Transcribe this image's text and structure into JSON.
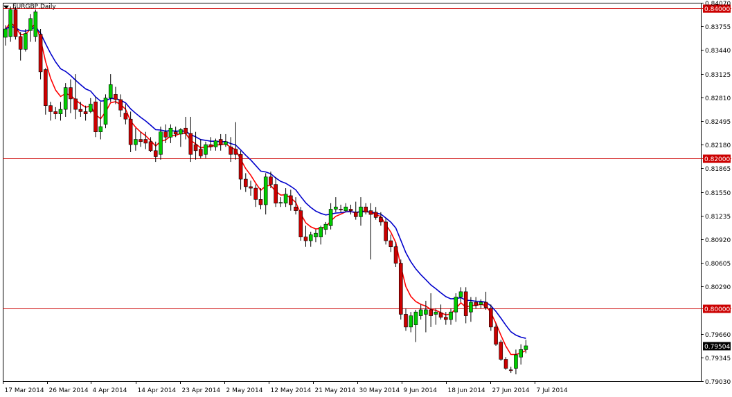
{
  "window": {
    "title": "EURGBP,Daily"
  },
  "chart_data": {
    "type": "candlestick",
    "symbol": "EURGBP",
    "timeframe": "Daily",
    "ylim": [
      0.7903,
      0.8407
    ],
    "y_ticks": [
      "0.84070",
      "0.83755",
      "0.83440",
      "0.83125",
      "0.82810",
      "0.82495",
      "0.82180",
      "0.81865",
      "0.81550",
      "0.81235",
      "0.80920",
      "0.80605",
      "0.80290",
      "0.79660",
      "0.79345",
      "0.79030"
    ],
    "x_ticks": [
      "17 Mar 2014",
      "26 Mar 2014",
      "4 Apr 2014",
      "14 Apr 2014",
      "23 Apr 2014",
      "2 May 2014",
      "12 May 2014",
      "21 May 2014",
      "30 May 2014",
      "9 Jun 2014",
      "18 Jun 2014",
      "27 Jun 2014",
      "7 Jul 2014"
    ],
    "horizontal_lines": [
      {
        "value": 0.84,
        "label": "0.84000"
      },
      {
        "value": 0.82,
        "label": "0.82000"
      },
      {
        "value": 0.8,
        "label": "0.80000"
      }
    ],
    "current_price": {
      "value": 0.79504,
      "label": "0.79504"
    },
    "candles": [
      {
        "o": 0.8361,
        "h": 0.8377,
        "l": 0.835,
        "c": 0.8372
      },
      {
        "o": 0.8362,
        "h": 0.8402,
        "l": 0.8355,
        "c": 0.8398
      },
      {
        "o": 0.8398,
        "h": 0.8402,
        "l": 0.8358,
        "c": 0.8362
      },
      {
        "o": 0.8362,
        "h": 0.8368,
        "l": 0.833,
        "c": 0.8345
      },
      {
        "o": 0.8345,
        "h": 0.8372,
        "l": 0.8342,
        "c": 0.8366
      },
      {
        "o": 0.837,
        "h": 0.8392,
        "l": 0.8355,
        "c": 0.8386
      },
      {
        "o": 0.8362,
        "h": 0.8398,
        "l": 0.8355,
        "c": 0.8395
      },
      {
        "o": 0.8365,
        "h": 0.8372,
        "l": 0.8305,
        "c": 0.8315
      },
      {
        "o": 0.8318,
        "h": 0.832,
        "l": 0.8258,
        "c": 0.827
      },
      {
        "o": 0.827,
        "h": 0.8275,
        "l": 0.825,
        "c": 0.8262
      },
      {
        "o": 0.8262,
        "h": 0.8268,
        "l": 0.8252,
        "c": 0.8259
      },
      {
        "o": 0.8259,
        "h": 0.8275,
        "l": 0.825,
        "c": 0.8265
      },
      {
        "o": 0.8265,
        "h": 0.83,
        "l": 0.8255,
        "c": 0.8294
      },
      {
        "o": 0.8294,
        "h": 0.8305,
        "l": 0.826,
        "c": 0.8279
      },
      {
        "o": 0.8279,
        "h": 0.8312,
        "l": 0.8252,
        "c": 0.8265
      },
      {
        "o": 0.8265,
        "h": 0.8275,
        "l": 0.8255,
        "c": 0.8262
      },
      {
        "o": 0.8262,
        "h": 0.827,
        "l": 0.825,
        "c": 0.8259
      },
      {
        "o": 0.8262,
        "h": 0.828,
        "l": 0.826,
        "c": 0.8272
      },
      {
        "o": 0.8275,
        "h": 0.8282,
        "l": 0.8228,
        "c": 0.8235
      },
      {
        "o": 0.8235,
        "h": 0.8275,
        "l": 0.8225,
        "c": 0.8242
      },
      {
        "o": 0.8245,
        "h": 0.8285,
        "l": 0.824,
        "c": 0.828
      },
      {
        "o": 0.828,
        "h": 0.8312,
        "l": 0.8275,
        "c": 0.8298
      },
      {
        "o": 0.8285,
        "h": 0.8295,
        "l": 0.8272,
        "c": 0.8278
      },
      {
        "o": 0.8278,
        "h": 0.8285,
        "l": 0.8255,
        "c": 0.8264
      },
      {
        "o": 0.826,
        "h": 0.8272,
        "l": 0.8245,
        "c": 0.8252
      },
      {
        "o": 0.8252,
        "h": 0.8262,
        "l": 0.8208,
        "c": 0.8218
      },
      {
        "o": 0.8218,
        "h": 0.824,
        "l": 0.821,
        "c": 0.8225
      },
      {
        "o": 0.8225,
        "h": 0.8235,
        "l": 0.8215,
        "c": 0.8222
      },
      {
        "o": 0.8225,
        "h": 0.8235,
        "l": 0.8212,
        "c": 0.822
      },
      {
        "o": 0.8222,
        "h": 0.8228,
        "l": 0.8208,
        "c": 0.821
      },
      {
        "o": 0.821,
        "h": 0.8222,
        "l": 0.8195,
        "c": 0.8202
      },
      {
        "o": 0.8205,
        "h": 0.8242,
        "l": 0.8198,
        "c": 0.8235
      },
      {
        "o": 0.8235,
        "h": 0.8245,
        "l": 0.822,
        "c": 0.8228
      },
      {
        "o": 0.8228,
        "h": 0.8245,
        "l": 0.822,
        "c": 0.824
      },
      {
        "o": 0.8235,
        "h": 0.8242,
        "l": 0.8228,
        "c": 0.8232
      },
      {
        "o": 0.8232,
        "h": 0.824,
        "l": 0.8215,
        "c": 0.8238
      },
      {
        "o": 0.824,
        "h": 0.8255,
        "l": 0.8225,
        "c": 0.8233
      },
      {
        "o": 0.8233,
        "h": 0.8255,
        "l": 0.8195,
        "c": 0.8205
      },
      {
        "o": 0.8218,
        "h": 0.8235,
        "l": 0.8198,
        "c": 0.821
      },
      {
        "o": 0.8212,
        "h": 0.8225,
        "l": 0.82,
        "c": 0.8203
      },
      {
        "o": 0.8205,
        "h": 0.8222,
        "l": 0.82,
        "c": 0.8218
      },
      {
        "o": 0.8218,
        "h": 0.8228,
        "l": 0.821,
        "c": 0.8215
      },
      {
        "o": 0.8215,
        "h": 0.8226,
        "l": 0.821,
        "c": 0.8223
      },
      {
        "o": 0.8225,
        "h": 0.8232,
        "l": 0.821,
        "c": 0.8218
      },
      {
        "o": 0.8218,
        "h": 0.8232,
        "l": 0.8215,
        "c": 0.8222
      },
      {
        "o": 0.8215,
        "h": 0.8228,
        "l": 0.8195,
        "c": 0.8205
      },
      {
        "o": 0.8212,
        "h": 0.8248,
        "l": 0.8198,
        "c": 0.8205
      },
      {
        "o": 0.8205,
        "h": 0.821,
        "l": 0.8158,
        "c": 0.8172
      },
      {
        "o": 0.8172,
        "h": 0.818,
        "l": 0.8155,
        "c": 0.8162
      },
      {
        "o": 0.8162,
        "h": 0.817,
        "l": 0.815,
        "c": 0.816
      },
      {
        "o": 0.816,
        "h": 0.8165,
        "l": 0.8135,
        "c": 0.8145
      },
      {
        "o": 0.8145,
        "h": 0.816,
        "l": 0.8132,
        "c": 0.8138
      },
      {
        "o": 0.8138,
        "h": 0.818,
        "l": 0.8125,
        "c": 0.8175
      },
      {
        "o": 0.8175,
        "h": 0.8182,
        "l": 0.816,
        "c": 0.8165
      },
      {
        "o": 0.8165,
        "h": 0.8175,
        "l": 0.8135,
        "c": 0.814
      },
      {
        "o": 0.814,
        "h": 0.8148,
        "l": 0.8135,
        "c": 0.8141
      },
      {
        "o": 0.814,
        "h": 0.816,
        "l": 0.8135,
        "c": 0.8152
      },
      {
        "o": 0.815,
        "h": 0.8158,
        "l": 0.813,
        "c": 0.8138
      },
      {
        "o": 0.8135,
        "h": 0.8148,
        "l": 0.8125,
        "c": 0.813
      },
      {
        "o": 0.813,
        "h": 0.8135,
        "l": 0.809,
        "c": 0.8095
      },
      {
        "o": 0.8095,
        "h": 0.811,
        "l": 0.8082,
        "c": 0.809
      },
      {
        "o": 0.809,
        "h": 0.8102,
        "l": 0.8082,
        "c": 0.8098
      },
      {
        "o": 0.8095,
        "h": 0.8105,
        "l": 0.8088,
        "c": 0.81
      },
      {
        "o": 0.8095,
        "h": 0.811,
        "l": 0.8085,
        "c": 0.8108
      },
      {
        "o": 0.8105,
        "h": 0.8115,
        "l": 0.8098,
        "c": 0.8112
      },
      {
        "o": 0.811,
        "h": 0.814,
        "l": 0.8105,
        "c": 0.8132
      },
      {
        "o": 0.8132,
        "h": 0.8148,
        "l": 0.8128,
        "c": 0.8135
      },
      {
        "o": 0.8132,
        "h": 0.8138,
        "l": 0.8128,
        "c": 0.8131
      },
      {
        "o": 0.813,
        "h": 0.814,
        "l": 0.8128,
        "c": 0.8135
      },
      {
        "o": 0.8132,
        "h": 0.8138,
        "l": 0.8125,
        "c": 0.813
      },
      {
        "o": 0.8128,
        "h": 0.8142,
        "l": 0.8118,
        "c": 0.8122
      },
      {
        "o": 0.8122,
        "h": 0.8148,
        "l": 0.811,
        "c": 0.8135
      },
      {
        "o": 0.8135,
        "h": 0.814,
        "l": 0.8125,
        "c": 0.8128
      },
      {
        "o": 0.813,
        "h": 0.814,
        "l": 0.8065,
        "c": 0.8125
      },
      {
        "o": 0.8128,
        "h": 0.8135,
        "l": 0.8118,
        "c": 0.8121
      },
      {
        "o": 0.8121,
        "h": 0.8128,
        "l": 0.811,
        "c": 0.8115
      },
      {
        "o": 0.8115,
        "h": 0.812,
        "l": 0.8085,
        "c": 0.809
      },
      {
        "o": 0.809,
        "h": 0.8098,
        "l": 0.8075,
        "c": 0.8082
      },
      {
        "o": 0.8082,
        "h": 0.8088,
        "l": 0.8055,
        "c": 0.806
      },
      {
        "o": 0.806,
        "h": 0.8065,
        "l": 0.7985,
        "c": 0.7992
      },
      {
        "o": 0.7992,
        "h": 0.8,
        "l": 0.797,
        "c": 0.7975
      },
      {
        "o": 0.7975,
        "h": 0.7995,
        "l": 0.7968,
        "c": 0.799
      },
      {
        "o": 0.7978,
        "h": 0.7998,
        "l": 0.7955,
        "c": 0.7995
      },
      {
        "o": 0.799,
        "h": 0.8005,
        "l": 0.7985,
        "c": 0.7998
      },
      {
        "o": 0.7992,
        "h": 0.801,
        "l": 0.7968,
        "c": 0.7998
      },
      {
        "o": 0.7998,
        "h": 0.802,
        "l": 0.7975,
        "c": 0.799
      },
      {
        "o": 0.7992,
        "h": 0.8,
        "l": 0.7978,
        "c": 0.7995
      },
      {
        "o": 0.7994,
        "h": 0.8005,
        "l": 0.7985,
        "c": 0.7988
      },
      {
        "o": 0.7988,
        "h": 0.7995,
        "l": 0.7978,
        "c": 0.7985
      },
      {
        "o": 0.7985,
        "h": 0.8,
        "l": 0.7978,
        "c": 0.7995
      },
      {
        "o": 0.7995,
        "h": 0.802,
        "l": 0.7982,
        "c": 0.8015
      },
      {
        "o": 0.8015,
        "h": 0.8028,
        "l": 0.8008,
        "c": 0.8022
      },
      {
        "o": 0.8022,
        "h": 0.8028,
        "l": 0.798,
        "c": 0.799
      },
      {
        "o": 0.7995,
        "h": 0.8015,
        "l": 0.7982,
        "c": 0.8008
      },
      {
        "o": 0.8008,
        "h": 0.8015,
        "l": 0.8,
        "c": 0.8004
      },
      {
        "o": 0.8005,
        "h": 0.8012,
        "l": 0.8,
        "c": 0.8008
      },
      {
        "o": 0.8008,
        "h": 0.8022,
        "l": 0.7998,
        "c": 0.8001
      },
      {
        "o": 0.8,
        "h": 0.8005,
        "l": 0.797,
        "c": 0.7975
      },
      {
        "o": 0.7975,
        "h": 0.798,
        "l": 0.795,
        "c": 0.7952
      },
      {
        "o": 0.7955,
        "h": 0.7958,
        "l": 0.793,
        "c": 0.7932
      },
      {
        "o": 0.7932,
        "h": 0.7935,
        "l": 0.7918,
        "c": 0.792
      },
      {
        "o": 0.7918,
        "h": 0.7922,
        "l": 0.7914,
        "c": 0.7917
      },
      {
        "o": 0.792,
        "h": 0.7945,
        "l": 0.7912,
        "c": 0.7938
      },
      {
        "o": 0.7935,
        "h": 0.7952,
        "l": 0.7925,
        "c": 0.7945
      },
      {
        "o": 0.7945,
        "h": 0.7958,
        "l": 0.794,
        "c": 0.795
      }
    ],
    "ma_colors": [
      "#ff0000",
      "#0000cc"
    ],
    "colors": {
      "bull": "#00cc00",
      "bear": "#cc0000",
      "wick": "#000000",
      "level_line": "#cc0000",
      "grid": "#000000"
    }
  }
}
